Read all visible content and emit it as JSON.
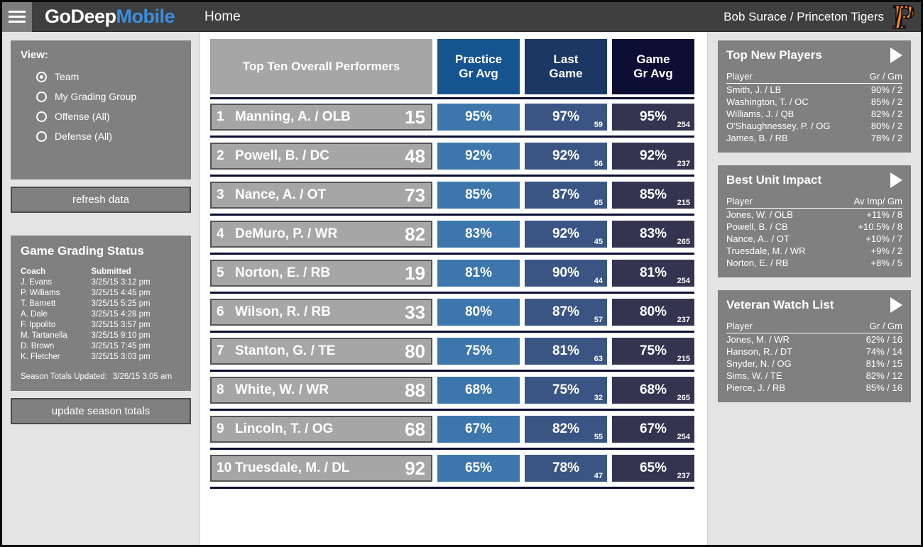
{
  "header": {
    "menu_icon": "hamburger-icon",
    "brand_primary": "GoDeep",
    "brand_secondary": "Mobile",
    "nav_home": "Home",
    "user": "Bob Surace / Princeton Tigers",
    "logo_icon": "princeton-tigers-logo",
    "bg_color": "#3f3f3f",
    "brand_accent": "#3b8fe0"
  },
  "sidebar_left": {
    "view": {
      "title": "View:",
      "options": [
        {
          "label": "Team",
          "selected": true
        },
        {
          "label": "My Grading Group",
          "selected": false
        },
        {
          "label": "Offense (All)",
          "selected": false
        },
        {
          "label": "Defense (All)",
          "selected": false
        }
      ],
      "refresh_label": "refresh data"
    },
    "status": {
      "title": "Game Grading Status",
      "col_coach": "Coach",
      "col_submitted": "Submitted",
      "rows": [
        {
          "coach": "J. Evans",
          "submitted": "3/25/15 3:12 pm"
        },
        {
          "coach": "P. Williams",
          "submitted": "3/25/15 4:45 pm"
        },
        {
          "coach": "T. Barnett",
          "submitted": "3/25/15 5:25 pm"
        },
        {
          "coach": "A. Dale",
          "submitted": "3/25/15 4:28 pm"
        },
        {
          "coach": "F. Ippolito",
          "submitted": "3/25/15 3:57 pm"
        },
        {
          "coach": "M. Tartanella",
          "submitted": "3/25/15 9:10 pm"
        },
        {
          "coach": "D. Brown",
          "submitted": "3/25/15 7:45 pm"
        },
        {
          "coach": "K. Fletcher",
          "submitted": "3/25/15 3:03 pm"
        }
      ],
      "season_label": "Season Totals Updated:",
      "season_value": "3/26/15 3:05 am",
      "update_label": "update season totals"
    }
  },
  "main": {
    "headers": {
      "name": "Top Ten Overall Performers",
      "practice": "Practice\nGr Avg",
      "practice_l1": "Practice",
      "practice_l2": "Gr Avg",
      "last_l1": "Last",
      "last_l2": "Game",
      "game_l1": "Game",
      "game_l2": "Gr Avg"
    },
    "colors": {
      "header_practice": "#16548f",
      "header_last": "#1b3864",
      "header_game": "#0c0e33",
      "cell_practice": "#3c76ab",
      "cell_last": "#3a5584",
      "cell_game": "#343350",
      "name_cell": "#a6a6a6"
    },
    "rows": [
      {
        "rank": "1",
        "player": "Manning, A. / OLB",
        "jersey": "15",
        "practice": "95%",
        "last": "97%",
        "last_sub": "59",
        "game": "95%",
        "game_sub": "254"
      },
      {
        "rank": "2",
        "player": "Powell, B. / DC",
        "jersey": "48",
        "practice": "92%",
        "last": "92%",
        "last_sub": "56",
        "game": "92%",
        "game_sub": "237"
      },
      {
        "rank": "3",
        "player": "Nance, A. / OT",
        "jersey": "73",
        "practice": "85%",
        "last": "87%",
        "last_sub": "65",
        "game": "85%",
        "game_sub": "215"
      },
      {
        "rank": "4",
        "player": "DeMuro, P. / WR",
        "jersey": "82",
        "practice": "83%",
        "last": "92%",
        "last_sub": "45",
        "game": "83%",
        "game_sub": "265"
      },
      {
        "rank": "5",
        "player": "Norton, E. / RB",
        "jersey": "19",
        "practice": "81%",
        "last": "90%",
        "last_sub": "44",
        "game": "81%",
        "game_sub": "254"
      },
      {
        "rank": "6",
        "player": "Wilson, R. / RB",
        "jersey": "33",
        "practice": "80%",
        "last": "87%",
        "last_sub": "57",
        "game": "80%",
        "game_sub": "237"
      },
      {
        "rank": "7",
        "player": "Stanton, G. / TE",
        "jersey": "80",
        "practice": "75%",
        "last": "81%",
        "last_sub": "63",
        "game": "75%",
        "game_sub": "215"
      },
      {
        "rank": "8",
        "player": "White, W. / WR",
        "jersey": "88",
        "practice": "68%",
        "last": "75%",
        "last_sub": "32",
        "game": "68%",
        "game_sub": "265"
      },
      {
        "rank": "9",
        "player": "Lincoln, T. / OG",
        "jersey": "68",
        "practice": "67%",
        "last": "82%",
        "last_sub": "55",
        "game": "67%",
        "game_sub": "254"
      },
      {
        "rank": "10",
        "player": "Truesdale, M. / DL",
        "jersey": "92",
        "practice": "65%",
        "last": "78%",
        "last_sub": "47",
        "game": "65%",
        "game_sub": "237"
      }
    ]
  },
  "sidebar_right": {
    "panels": [
      {
        "title": "Top New Players",
        "arrow_icon": "arrow-right-icon",
        "col_player": "Player",
        "col_value": "Gr / Gm",
        "rows": [
          {
            "player": "Smith, J. / LB",
            "value": "90% / 2"
          },
          {
            "player": "Washington, T. / OC",
            "value": "85% / 2"
          },
          {
            "player": "Williams, J. / QB",
            "value": "82% / 2"
          },
          {
            "player": "O'Shaughnessey, P. / OG",
            "value": "80% / 2"
          },
          {
            "player": "James, B. / RB",
            "value": "78% / 2"
          }
        ]
      },
      {
        "title": "Best Unit Impact",
        "arrow_icon": "arrow-right-icon",
        "col_player": "Player",
        "col_value": "Av Imp/ Gm",
        "rows": [
          {
            "player": "Jones, W. / OLB",
            "value": "+11% / 8"
          },
          {
            "player": "Powell, B. / CB",
            "value": "+10.5% / 8"
          },
          {
            "player": "Nance, A.. / OT",
            "value": "+10% / 7"
          },
          {
            "player": "Truesdale, M. / WR",
            "value": "+9% / 2"
          },
          {
            "player": "Norton, E. / RB",
            "value": "+8% / 5"
          }
        ]
      },
      {
        "title": "Veteran Watch List",
        "arrow_icon": "arrow-right-icon",
        "col_player": "Player",
        "col_value": "Gr / Gm",
        "rows": [
          {
            "player": "Jones, M. / WR",
            "value": "62% / 16"
          },
          {
            "player": "Hanson, R. / DT",
            "value": "74% / 14"
          },
          {
            "player": "Snyder, N. / OG",
            "value": "81% / 15"
          },
          {
            "player": "Sims, W. / TE",
            "value": "82% / 12"
          },
          {
            "player": "Pierce, J. / RB",
            "value": "85% / 16"
          }
        ]
      }
    ]
  }
}
